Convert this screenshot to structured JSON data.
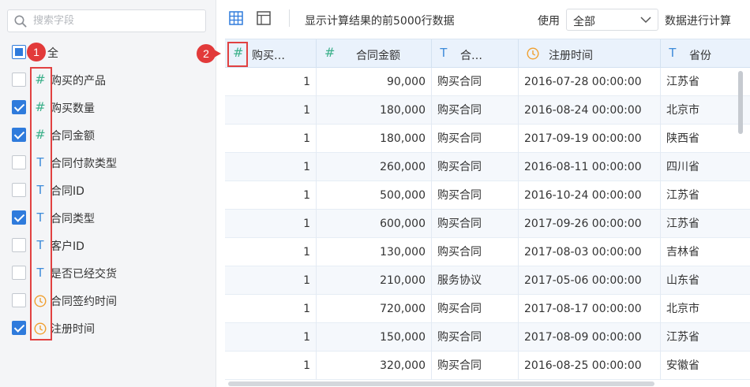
{
  "search": {
    "placeholder": "搜索字段"
  },
  "select_all": {
    "label": "全"
  },
  "fields": [
    {
      "label": "购买的产品",
      "type": "number",
      "checked": false
    },
    {
      "label": "购买数量",
      "type": "number",
      "checked": true
    },
    {
      "label": "合同金额",
      "type": "number",
      "checked": true
    },
    {
      "label": "合同付款类型",
      "type": "text",
      "checked": false
    },
    {
      "label": "合同ID",
      "type": "text",
      "checked": false
    },
    {
      "label": "合同类型",
      "type": "text",
      "checked": true
    },
    {
      "label": "客户ID",
      "type": "text",
      "checked": false
    },
    {
      "label": "是否已经交货",
      "type": "text",
      "checked": false
    },
    {
      "label": "合同签约时间",
      "type": "date",
      "checked": false
    },
    {
      "label": "注册时间",
      "type": "date",
      "checked": true
    }
  ],
  "icons": {
    "number": "#",
    "text": "T"
  },
  "annotations": {
    "badge1": "1",
    "badge2": "2"
  },
  "toolbar": {
    "description": "显示计算结果的前5000行数据",
    "use_label": "使用",
    "select_value": "全部",
    "suffix": "数据进行计算"
  },
  "table": {
    "columns": [
      {
        "label": "购买…",
        "type": "number"
      },
      {
        "label": "合同金额",
        "type": "number"
      },
      {
        "label": "合…",
        "type": "text"
      },
      {
        "label": "注册时间",
        "type": "date"
      },
      {
        "label": "省份",
        "type": "text"
      }
    ],
    "rows": [
      [
        "1",
        "90,000",
        "购买合同",
        "2016-07-28 00:00:00",
        "江苏省"
      ],
      [
        "1",
        "180,000",
        "购买合同",
        "2016-08-24 00:00:00",
        "北京市"
      ],
      [
        "1",
        "180,000",
        "购买合同",
        "2017-09-19 00:00:00",
        "陕西省"
      ],
      [
        "1",
        "260,000",
        "购买合同",
        "2016-08-11 00:00:00",
        "四川省"
      ],
      [
        "1",
        "500,000",
        "购买合同",
        "2016-10-24 00:00:00",
        "江苏省"
      ],
      [
        "1",
        "600,000",
        "购买合同",
        "2017-09-26 00:00:00",
        "江苏省"
      ],
      [
        "1",
        "130,000",
        "购买合同",
        "2017-08-03 00:00:00",
        "吉林省"
      ],
      [
        "1",
        "210,000",
        "服务协议",
        "2017-05-06 00:00:00",
        "山东省"
      ],
      [
        "1",
        "720,000",
        "购买合同",
        "2017-08-17 00:00:00",
        "北京市"
      ],
      [
        "1",
        "150,000",
        "购买合同",
        "2017-08-09 00:00:00",
        "江苏省"
      ],
      [
        "1",
        "320,000",
        "购买合同",
        "2016-08-25 00:00:00",
        "安徽省"
      ]
    ]
  },
  "colors": {
    "accent": "#2f7bdc",
    "number_icon": "#3bb08a",
    "text_icon": "#3d8bd9",
    "date_icon": "#f0a030",
    "annotation": "#e23a3a"
  }
}
